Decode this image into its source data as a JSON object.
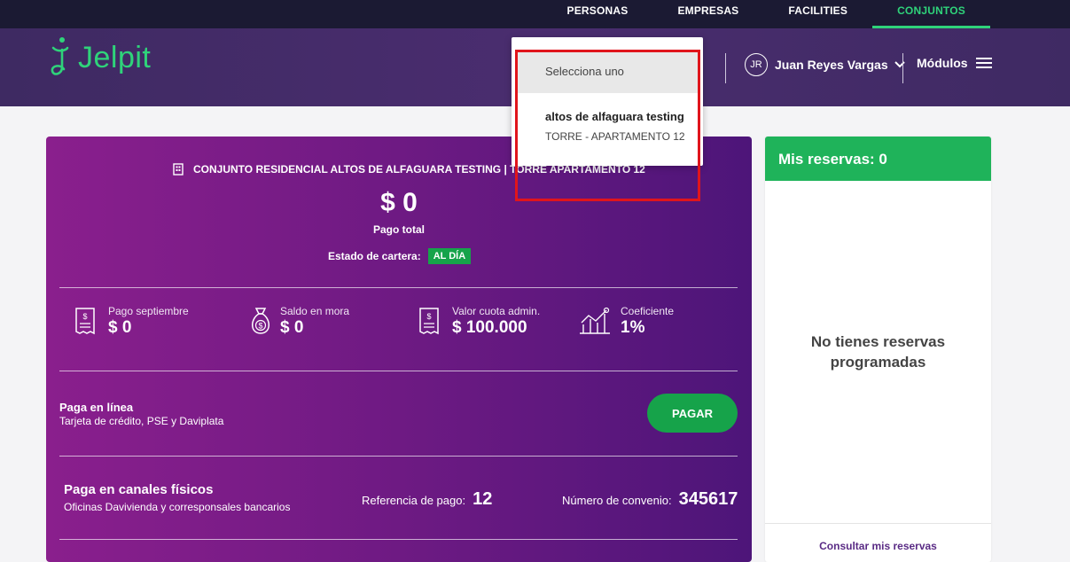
{
  "topnav": {
    "items": [
      "PERSONAS",
      "EMPRESAS",
      "FACILITIES",
      "CONJUNTOS"
    ],
    "active": "CONJUNTOS"
  },
  "header": {
    "logo_text": "Jelpit",
    "user": {
      "initials": "JR",
      "name": "Juan Reyes Vargas"
    },
    "modulos_label": "Módulos"
  },
  "dropdown": {
    "placeholder": "Selecciona uno",
    "option_title": "altos de alfaguara testing",
    "option_sub": "TORRE - APARTAMENTO 12"
  },
  "card": {
    "conjunto": "CONJUNTO RESIDENCIAL ALTOS DE ALFAGUARA TESTING | TORRE APARTAMENTO 12",
    "amount": "$ 0",
    "pago_total": "Pago total",
    "estado_label": "Estado de cartera:",
    "estado_badge": "AL DÍA",
    "stats": [
      {
        "label": "Pago septiembre",
        "value": "$ 0"
      },
      {
        "label": "Saldo en mora",
        "value": "$ 0"
      },
      {
        "label": "Valor cuota admin.",
        "value": "$ 100.000"
      },
      {
        "label": "Coeficiente",
        "value": "1%"
      }
    ],
    "pago_linea_title": "Paga en línea",
    "pago_linea_sub": "Tarjeta de crédito, PSE y Daviplata",
    "pagar_label": "PAGAR",
    "pago_fisico_title": "Paga en canales físicos",
    "pago_fisico_sub": "Oficinas Davivienda y corresponsales bancarios",
    "referencia_label": "Referencia de pago:",
    "referencia_value": "12",
    "convenio_label": "Número de convenio:",
    "convenio_value": "345617"
  },
  "side": {
    "title": "Mis reservas: 0",
    "empty_line1": "No tienes reservas",
    "empty_line2": "programadas",
    "consultar": "Consultar mis reservas"
  },
  "colors": {
    "accent_green": "#2fd37a",
    "button_green": "#16a34a",
    "header_purple": "#4a2d6f",
    "card_purple": "#6e1a83",
    "highlight_red": "#e0151c"
  }
}
